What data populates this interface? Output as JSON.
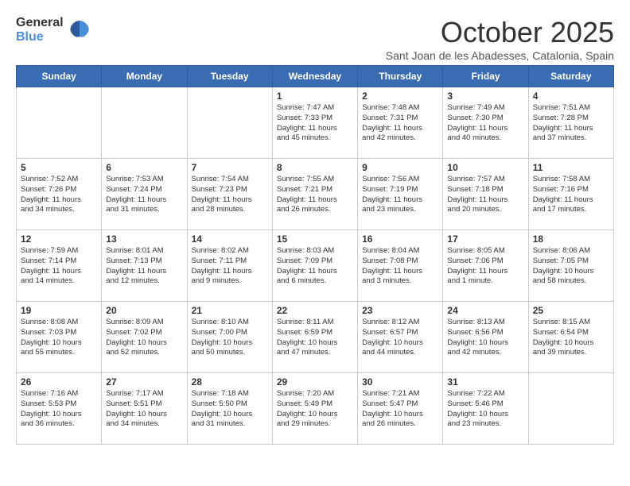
{
  "logo": {
    "line1": "General",
    "line2": "Blue"
  },
  "title": "October 2025",
  "subtitle": "Sant Joan de les Abadesses, Catalonia, Spain",
  "days_of_week": [
    "Sunday",
    "Monday",
    "Tuesday",
    "Wednesday",
    "Thursday",
    "Friday",
    "Saturday"
  ],
  "weeks": [
    [
      {
        "day": "",
        "info": ""
      },
      {
        "day": "",
        "info": ""
      },
      {
        "day": "",
        "info": ""
      },
      {
        "day": "1",
        "info": "Sunrise: 7:47 AM\nSunset: 7:33 PM\nDaylight: 11 hours\nand 45 minutes."
      },
      {
        "day": "2",
        "info": "Sunrise: 7:48 AM\nSunset: 7:31 PM\nDaylight: 11 hours\nand 42 minutes."
      },
      {
        "day": "3",
        "info": "Sunrise: 7:49 AM\nSunset: 7:30 PM\nDaylight: 11 hours\nand 40 minutes."
      },
      {
        "day": "4",
        "info": "Sunrise: 7:51 AM\nSunset: 7:28 PM\nDaylight: 11 hours\nand 37 minutes."
      }
    ],
    [
      {
        "day": "5",
        "info": "Sunrise: 7:52 AM\nSunset: 7:26 PM\nDaylight: 11 hours\nand 34 minutes."
      },
      {
        "day": "6",
        "info": "Sunrise: 7:53 AM\nSunset: 7:24 PM\nDaylight: 11 hours\nand 31 minutes."
      },
      {
        "day": "7",
        "info": "Sunrise: 7:54 AM\nSunset: 7:23 PM\nDaylight: 11 hours\nand 28 minutes."
      },
      {
        "day": "8",
        "info": "Sunrise: 7:55 AM\nSunset: 7:21 PM\nDaylight: 11 hours\nand 26 minutes."
      },
      {
        "day": "9",
        "info": "Sunrise: 7:56 AM\nSunset: 7:19 PM\nDaylight: 11 hours\nand 23 minutes."
      },
      {
        "day": "10",
        "info": "Sunrise: 7:57 AM\nSunset: 7:18 PM\nDaylight: 11 hours\nand 20 minutes."
      },
      {
        "day": "11",
        "info": "Sunrise: 7:58 AM\nSunset: 7:16 PM\nDaylight: 11 hours\nand 17 minutes."
      }
    ],
    [
      {
        "day": "12",
        "info": "Sunrise: 7:59 AM\nSunset: 7:14 PM\nDaylight: 11 hours\nand 14 minutes."
      },
      {
        "day": "13",
        "info": "Sunrise: 8:01 AM\nSunset: 7:13 PM\nDaylight: 11 hours\nand 12 minutes."
      },
      {
        "day": "14",
        "info": "Sunrise: 8:02 AM\nSunset: 7:11 PM\nDaylight: 11 hours\nand 9 minutes."
      },
      {
        "day": "15",
        "info": "Sunrise: 8:03 AM\nSunset: 7:09 PM\nDaylight: 11 hours\nand 6 minutes."
      },
      {
        "day": "16",
        "info": "Sunrise: 8:04 AM\nSunset: 7:08 PM\nDaylight: 11 hours\nand 3 minutes."
      },
      {
        "day": "17",
        "info": "Sunrise: 8:05 AM\nSunset: 7:06 PM\nDaylight: 11 hours\nand 1 minute."
      },
      {
        "day": "18",
        "info": "Sunrise: 8:06 AM\nSunset: 7:05 PM\nDaylight: 10 hours\nand 58 minutes."
      }
    ],
    [
      {
        "day": "19",
        "info": "Sunrise: 8:08 AM\nSunset: 7:03 PM\nDaylight: 10 hours\nand 55 minutes."
      },
      {
        "day": "20",
        "info": "Sunrise: 8:09 AM\nSunset: 7:02 PM\nDaylight: 10 hours\nand 52 minutes."
      },
      {
        "day": "21",
        "info": "Sunrise: 8:10 AM\nSunset: 7:00 PM\nDaylight: 10 hours\nand 50 minutes."
      },
      {
        "day": "22",
        "info": "Sunrise: 8:11 AM\nSunset: 6:59 PM\nDaylight: 10 hours\nand 47 minutes."
      },
      {
        "day": "23",
        "info": "Sunrise: 8:12 AM\nSunset: 6:57 PM\nDaylight: 10 hours\nand 44 minutes."
      },
      {
        "day": "24",
        "info": "Sunrise: 8:13 AM\nSunset: 6:56 PM\nDaylight: 10 hours\nand 42 minutes."
      },
      {
        "day": "25",
        "info": "Sunrise: 8:15 AM\nSunset: 6:54 PM\nDaylight: 10 hours\nand 39 minutes."
      }
    ],
    [
      {
        "day": "26",
        "info": "Sunrise: 7:16 AM\nSunset: 5:53 PM\nDaylight: 10 hours\nand 36 minutes."
      },
      {
        "day": "27",
        "info": "Sunrise: 7:17 AM\nSunset: 5:51 PM\nDaylight: 10 hours\nand 34 minutes."
      },
      {
        "day": "28",
        "info": "Sunrise: 7:18 AM\nSunset: 5:50 PM\nDaylight: 10 hours\nand 31 minutes."
      },
      {
        "day": "29",
        "info": "Sunrise: 7:20 AM\nSunset: 5:49 PM\nDaylight: 10 hours\nand 29 minutes."
      },
      {
        "day": "30",
        "info": "Sunrise: 7:21 AM\nSunset: 5:47 PM\nDaylight: 10 hours\nand 26 minutes."
      },
      {
        "day": "31",
        "info": "Sunrise: 7:22 AM\nSunset: 5:46 PM\nDaylight: 10 hours\nand 23 minutes."
      },
      {
        "day": "",
        "info": ""
      }
    ]
  ]
}
